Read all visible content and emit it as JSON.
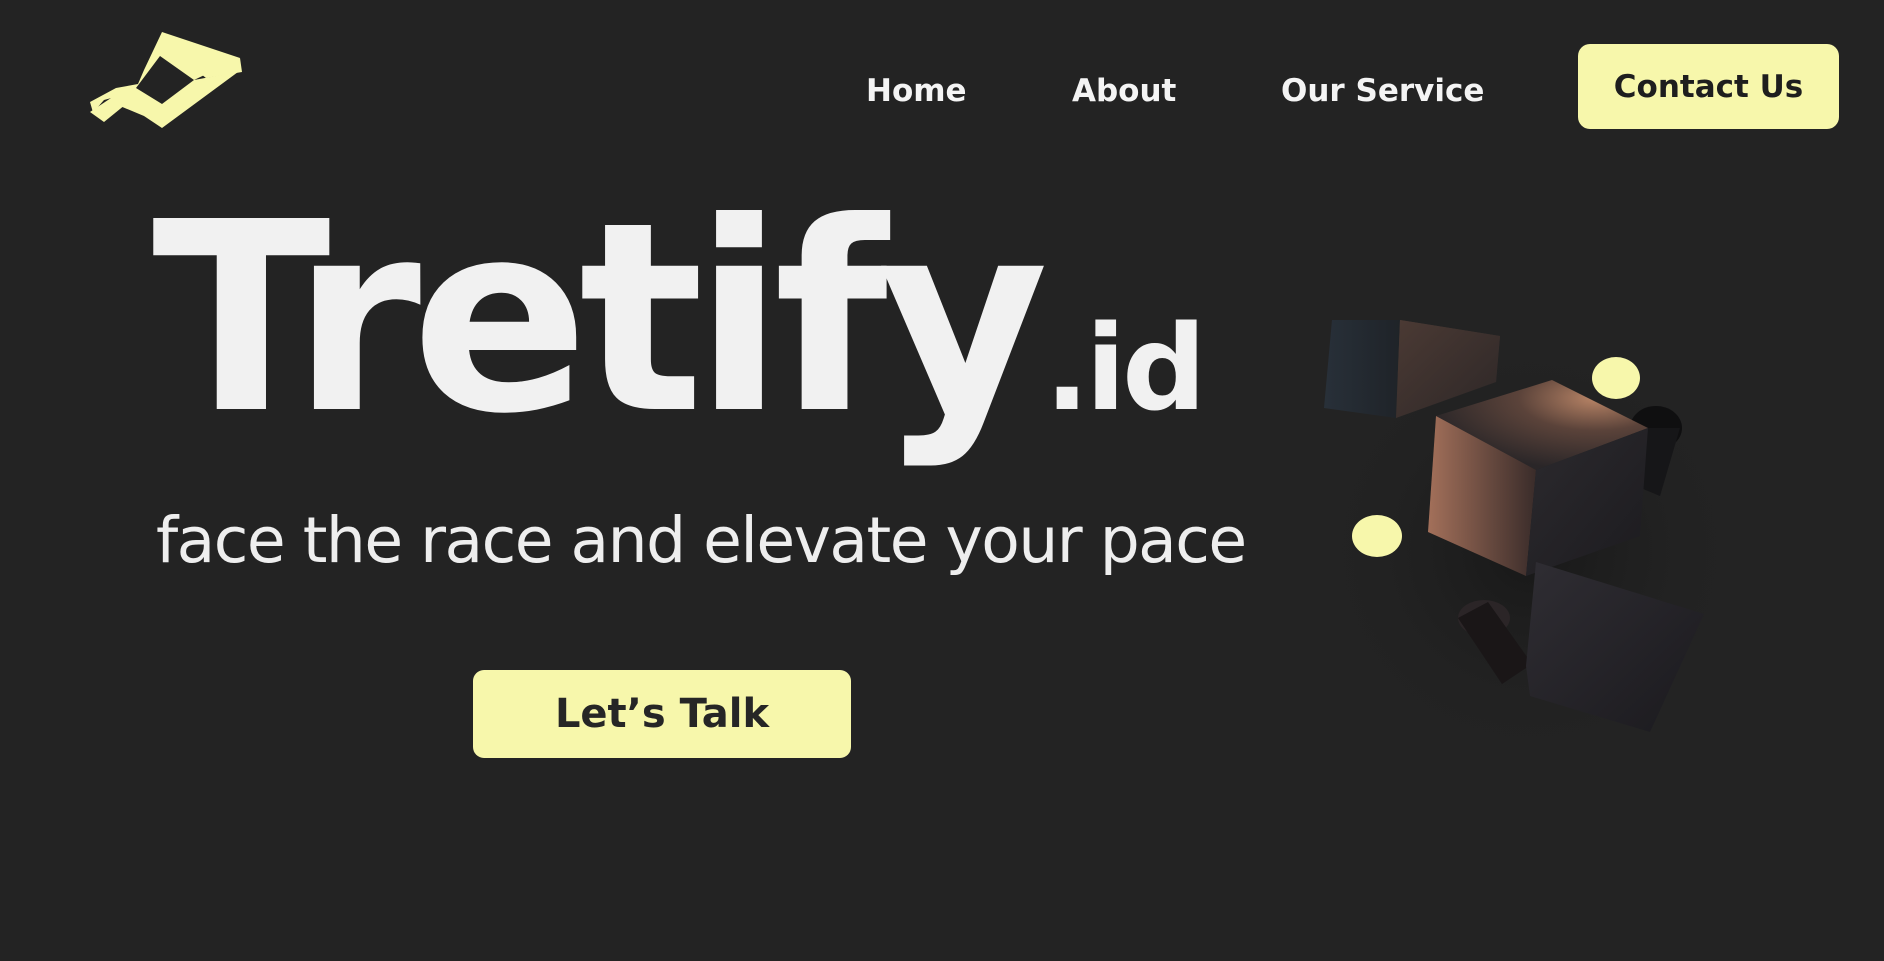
{
  "brand": {
    "logo_icon": "tretify-logo-icon",
    "accent_color": "#f7f7ab",
    "background_color": "#232323"
  },
  "nav": {
    "items": [
      {
        "label": "Home"
      },
      {
        "label": "About"
      },
      {
        "label": "Our Service"
      }
    ],
    "contact_label": "Contact Us"
  },
  "hero": {
    "title": "Tretify",
    "title_suffix": ".id",
    "tagline": "face the race and elevate your pace",
    "cta_label": "Let’s Talk"
  },
  "illustration": {
    "icon": "floating-cubes-illustration"
  }
}
